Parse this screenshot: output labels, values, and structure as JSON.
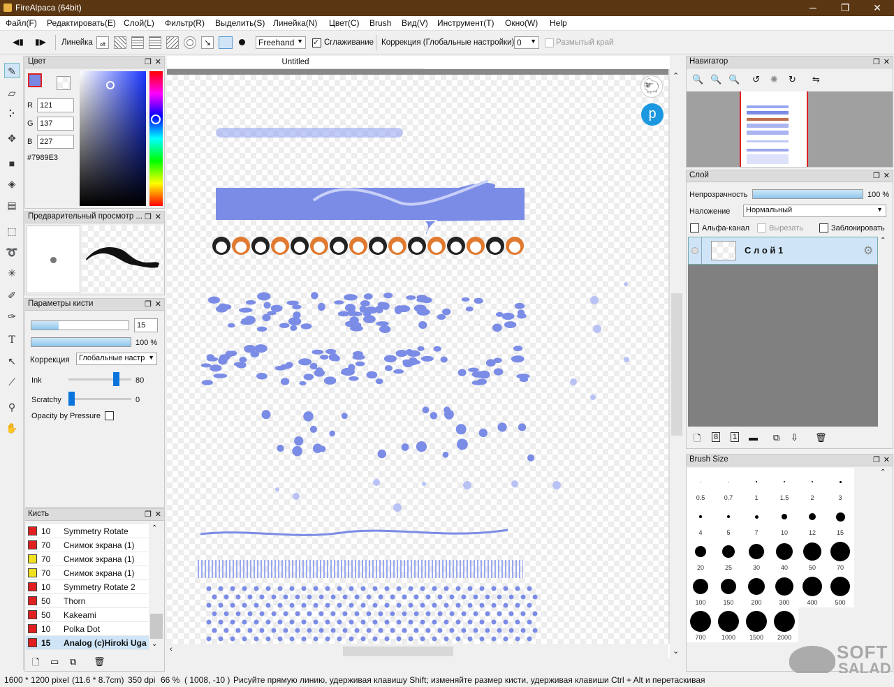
{
  "window": {
    "title": "FireAlpaca (64bit)",
    "minimize": "─",
    "maximize": "❐",
    "close": "✕"
  },
  "menu": [
    "Файл(F)",
    "Редактировать(E)",
    "Слой(L)",
    "Фильтр(R)",
    "Выделить(S)",
    "Линейка(N)",
    "Цвет(C)",
    "Brush",
    "Вид(V)",
    "Инструмент(T)",
    "Окно(W)",
    "Help"
  ],
  "toolbar": {
    "ruler_label": "Линейка",
    "mode": "Freehand",
    "smoothing": "Сглаживание",
    "correction_label": "Коррекция (Глобальные настройки)",
    "correction_value": "0",
    "blur_edge": "Размытый край"
  },
  "color_panel": {
    "title": "Цвет",
    "r_label": "R",
    "r": "121",
    "g_label": "G",
    "g": "137",
    "b_label": "B",
    "b": "227",
    "hex": "#7989E3",
    "current_color": "#7989E3"
  },
  "preview_panel": {
    "title": "Предварительный просмотр ..."
  },
  "brush_params": {
    "title": "Параметры кисти",
    "size": "15",
    "opacity": "100 %",
    "size_fraction": 0.28,
    "opacity_fraction": 1.0,
    "correction_label": "Коррекция",
    "correction_value": "Глобальные настр",
    "ink_label": "Ink",
    "ink_value": "80",
    "scratchy_label": "Scratchy",
    "scratchy_value": "0",
    "opacity_pressure": "Opacity by Pressure"
  },
  "brush_panel": {
    "title": "Кисть",
    "items": [
      {
        "size": "10",
        "name": "Symmetry Rotate",
        "color": "#e02020"
      },
      {
        "size": "70",
        "name": "Снимок экрана (1)",
        "color": "#e02020"
      },
      {
        "size": "70",
        "name": "Снимок экрана (1)",
        "color": "#f0e020"
      },
      {
        "size": "70",
        "name": "Снимок экрана (1)",
        "color": "#f0e020"
      },
      {
        "size": "10",
        "name": "Symmetry Rotate 2",
        "color": "#e02020"
      },
      {
        "size": "50",
        "name": "Thorn",
        "color": "#e02020"
      },
      {
        "size": "50",
        "name": "Kakeami",
        "color": "#e02020"
      },
      {
        "size": "10",
        "name": "Polka Dot",
        "color": "#e02020"
      },
      {
        "size": "15",
        "name": "Analog (c)Hiroki Uga",
        "color": "#e02020"
      }
    ]
  },
  "canvas": {
    "tab": "Untitled"
  },
  "navigator": {
    "title": "Навигатор"
  },
  "layer_panel": {
    "title": "Слой",
    "opacity_label": "Непрозрачность",
    "opacity_value": "100 %",
    "opacity_fraction": 1.0,
    "blend_label": "Наложение",
    "blend_value": "Нормальный",
    "alpha_label": "Альфа-канал",
    "clip_label": "Вырезать",
    "lock_label": "Заблокировать",
    "layer_name": "С л о й 1"
  },
  "brush_size_panel": {
    "title": "Brush Size",
    "sizes": [
      "0.5",
      "0.7",
      "1",
      "1.5",
      "2",
      "3",
      "4",
      "5",
      "7",
      "10",
      "12",
      "15",
      "20",
      "25",
      "30",
      "40",
      "50",
      "70",
      "100",
      "150",
      "200",
      "300",
      "400",
      "500",
      "700",
      "1000",
      "1500",
      "2000"
    ]
  },
  "watermark": {
    "line1": "SOFT",
    "line2": "SALAD"
  },
  "status": {
    "dims": "1600 * 1200 pixel",
    "size": "(11.6 * 8.7cm)",
    "dpi": "350 dpi",
    "zoom": "66 %",
    "coords": "( 1008, -10 )",
    "hint": "Рисуйте прямую линию, удерживая клавишу Shift; изменяйте размер кисти, удерживая клавиши Ctrl + Alt и перетаскивая"
  }
}
